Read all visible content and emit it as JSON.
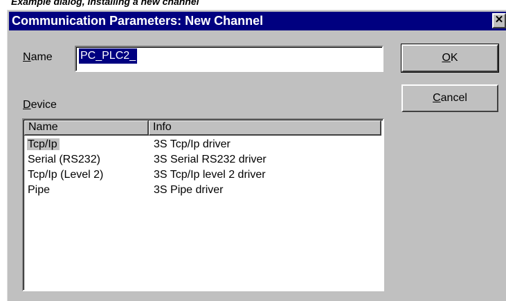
{
  "caption": "Example dialog, installing a new channel",
  "dialog": {
    "title": "Communication Parameters: New Channel",
    "close_glyph": "✕"
  },
  "name_field": {
    "label_underlined": "N",
    "label_rest": "ame",
    "value": "PC_PLC2_"
  },
  "device": {
    "label_underlined": "D",
    "label_rest": "evice",
    "columns": [
      "Name",
      "Info"
    ],
    "rows": [
      {
        "name": "Tcp/Ip",
        "info": "3S Tcp/Ip driver"
      },
      {
        "name": "Serial (RS232)",
        "info": "3S Serial RS232 driver"
      },
      {
        "name": "Tcp/Ip (Level 2)",
        "info": "3S Tcp/Ip level 2 driver"
      },
      {
        "name": "Pipe",
        "info": "3S Pipe driver"
      }
    ],
    "selected_index": 0
  },
  "buttons": {
    "ok_underlined": "O",
    "ok_rest": "K",
    "cancel_underlined": "C",
    "cancel_rest": "ancel"
  },
  "colors": {
    "titlebar": "#000080",
    "face": "#c0c0c0",
    "selection": "#000080"
  },
  "icons": {
    "close": "close-icon"
  }
}
